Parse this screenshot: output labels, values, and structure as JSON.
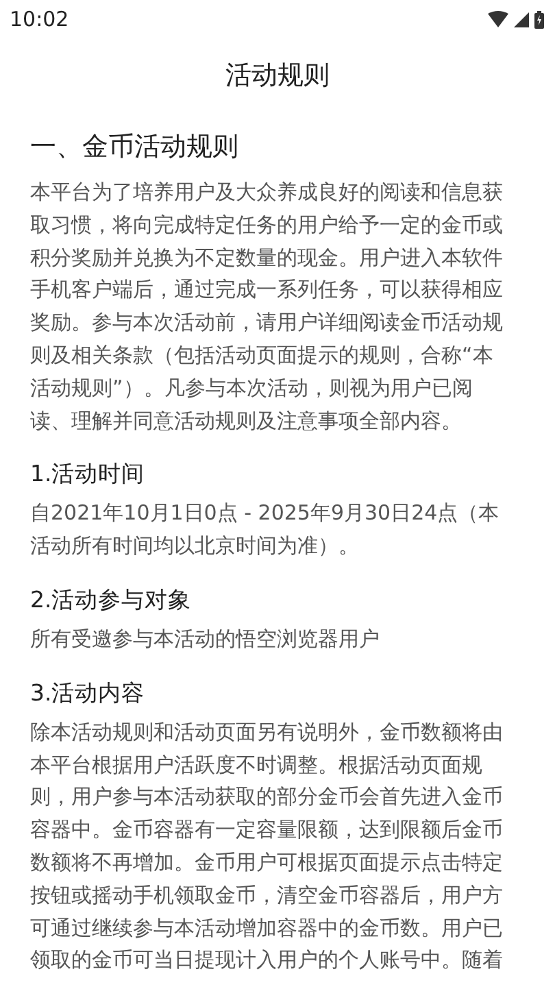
{
  "status_bar": {
    "time": "10:02"
  },
  "title": "活动规则",
  "section": {
    "heading": "一、金币活动规则",
    "text": "本平台为了培养用户及大众养成良好的阅读和信息获取习惯，将向完成特定任务的用户给予一定的金币或积分奖励并兑换为不定数量的现金。用户进入本软件手机客户端后，通过完成一系列任务，可以获得相应奖励。参与本次活动前，请用户详细阅读金币活动规则及相关条款（包括活动页面提示的规则，合称“本活动规则”）。凡参与本次活动，则视为用户已阅读、理解并同意活动规则及注意事项全部内容。"
  },
  "items": [
    {
      "heading": "1.活动时间",
      "text": "自2021年10月1日0点 - 2025年9月30日24点（本活动所有时间均以北京时间为准）。"
    },
    {
      "heading": "2.活动参与对象",
      "text": "所有受邀参与本活动的悟空浏览器用户"
    },
    {
      "heading": "3.活动内容",
      "text": "除本活动规则和活动页面另有说明外，金币数额将由本平台根据用户活跃度不时调整。根据活动页面规则，用户参与本活动获取的部分金币会首先进入金币容器中。金币容器有一定容量限额，达到限额后金币数额将不再增加。金币用户可根据页面提示点击特定按钮或摇动手机领取金币，清空金币容器后，用户方可通过继续参与本活动增加容器中的金币数。用户已领取的金币可当日提现计入用户的个人账号中。随着"
    }
  ]
}
